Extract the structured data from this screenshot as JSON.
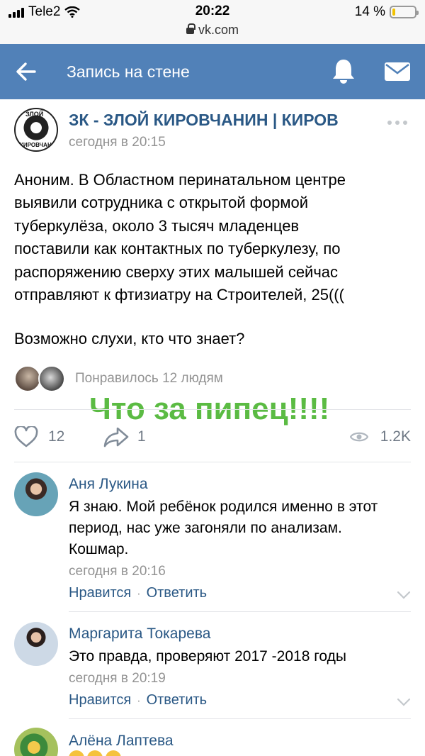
{
  "status_bar": {
    "carrier": "Tele2",
    "time": "20:22",
    "battery": "14 %",
    "battery_level": 0.14
  },
  "url_bar": {
    "url": "vk.com"
  },
  "header": {
    "title": "Запись на стене",
    "color": "#5181b8"
  },
  "post": {
    "author": "ЗК - ЗЛОЙ КИРОВЧАНИН | КИРОВ",
    "date": "сегодня в 20:15",
    "avatar_text_top": "ЗЛОЙ",
    "avatar_text_bottom": "КИРОВЧАНИН",
    "text_lines": [
      "Аноним. В Областном перинатальном центре",
      "выявили сотрудника с открытой формой",
      "туберкулёза, около 3 тысяч младенцев",
      "поставили как контактных по туберкулезу, по",
      "распоряжению сверху этих малышей сейчас",
      "отправляют к фтизиатру на Строителей, 25((("
    ],
    "question": "Возможно слухи, кто что знает?",
    "liked_by": "Понравилось 12 людям",
    "overlay_text": "Что за пипец!!!!",
    "likes": "12",
    "shares": "1",
    "views": "1.2K"
  },
  "comments": [
    {
      "name": "Аня Лукина",
      "text_lines": [
        "Я знаю. Мой ребёнок родился именно в этот",
        "период, нас уже загоняли по анализам.",
        "Кошмар."
      ],
      "date": "сегодня в 20:16",
      "like_label": "Нравится",
      "reply_label": "Ответить"
    },
    {
      "name": "Маргарита Токарева",
      "text_lines": [
        "Это правда, проверяют 2017 -2018 годы"
      ],
      "date": "сегодня в 20:19",
      "like_label": "Нравится",
      "reply_label": "Ответить"
    },
    {
      "name": "Алёна Лаптева"
    }
  ],
  "icons": {
    "back": "arrow-left-icon",
    "bell": "bell-icon",
    "mail": "mail-icon",
    "more": "more-icon",
    "like": "heart-icon",
    "share": "share-icon",
    "views": "eye-icon",
    "expand": "chevron-down-icon"
  }
}
